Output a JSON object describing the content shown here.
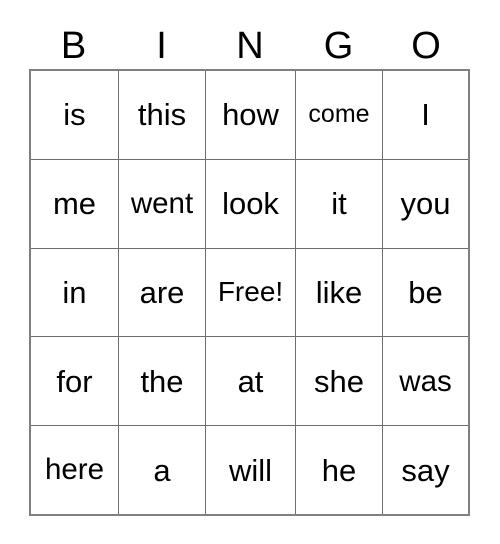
{
  "card": {
    "title": "BINGO",
    "header_letters": [
      "B",
      "I",
      "N",
      "G",
      "O"
    ],
    "columns": 5,
    "rows": 5,
    "free_space_label": "Free!",
    "free_space_position": {
      "row": 2,
      "col": 2
    },
    "colors": {
      "background": "#ffffff",
      "text": "#000000",
      "outer_border": "#808080",
      "inner_border": "#6e6e6e"
    },
    "grid": [
      [
        "is",
        "this",
        "how",
        "come",
        "I"
      ],
      [
        "me",
        "went",
        "look",
        "it",
        "you"
      ],
      [
        "in",
        "are",
        "Free!",
        "like",
        "be"
      ],
      [
        "for",
        "the",
        "at",
        "she",
        "was"
      ],
      [
        "here",
        "a",
        "will",
        "he",
        "say"
      ]
    ]
  }
}
